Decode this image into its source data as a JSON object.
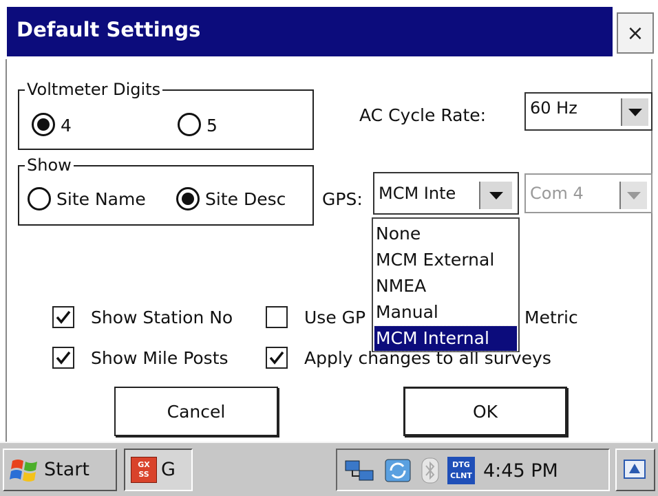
{
  "window": {
    "title": "Default Settings",
    "close_label": "×"
  },
  "voltmeter": {
    "legend": "Voltmeter Digits",
    "options": [
      {
        "label": "4",
        "selected": true
      },
      {
        "label": "5",
        "selected": false
      }
    ]
  },
  "ac_cycle": {
    "label": "AC Cycle Rate:",
    "value": "60 Hz"
  },
  "show": {
    "legend": "Show",
    "options": [
      {
        "label": "Site Name",
        "selected": false
      },
      {
        "label": "Site Desc",
        "selected": true
      }
    ]
  },
  "gps": {
    "label": "GPS:",
    "value": "MCM Inte",
    "port_value": "Com 4",
    "port_enabled": false,
    "dropdown": {
      "open": true,
      "options": [
        "None",
        "MCM External",
        "NMEA",
        "Manual",
        "MCM Internal"
      ],
      "selected": "MCM Internal"
    }
  },
  "checkboxes": [
    {
      "label": "Show Station No",
      "checked": true
    },
    {
      "label": "Use GP",
      "checked": false
    },
    {
      "label": "Metric",
      "checked": false
    },
    {
      "label": "Show Mile Posts",
      "checked": true
    },
    {
      "label": "Apply changes to all surveys",
      "checked": true
    }
  ],
  "buttons": {
    "cancel": "Cancel",
    "ok": "OK"
  },
  "taskbar": {
    "start": "Start",
    "app_label": "G",
    "app_icon_text": "GX SS",
    "tray_badge_text": "DTG CLNT",
    "clock": "4:45 PM"
  },
  "colors": {
    "title_bar": "#0c0c7c",
    "selection": "#0c0c7c",
    "taskbar": "#c7c7c7"
  },
  "icons": [
    "close-icon",
    "dropdown-arrow-icon",
    "checkmark-icon",
    "windows-flag-icon",
    "network-icon",
    "sync-icon",
    "bluetooth-icon",
    "desktop-icon"
  ]
}
